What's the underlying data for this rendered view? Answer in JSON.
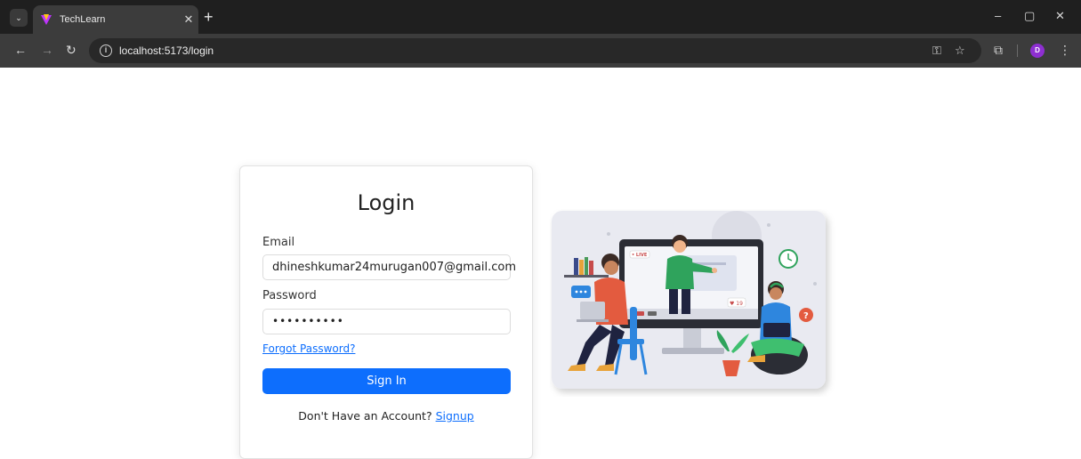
{
  "browser": {
    "tab_title": "TechLearn",
    "url": "localhost:5173/login",
    "profile_initial": "D",
    "icons": [
      "tab-menu-icon",
      "close-icon",
      "new-tab-icon",
      "minimize-icon",
      "restore-icon",
      "window-close-icon",
      "back-icon",
      "forward-icon",
      "reload-icon",
      "site-info-icon",
      "password-key-icon",
      "bookmark-star-icon",
      "extensions-icon",
      "more-menu-icon"
    ]
  },
  "login": {
    "title": "Login",
    "email_label": "Email",
    "email_value": "dhineshkumar24murugan007@gmail.com",
    "password_label": "Password",
    "password_value": "••••••••••",
    "forgot_label": "Forgot Password?",
    "signin_label": "Sign In",
    "signup_prompt": "Don't Have an Account?",
    "signup_link": "Signup"
  },
  "illustration": {
    "live_badge": "• LIVE",
    "counter_badge": "♥ 19"
  },
  "colors": {
    "primary": "#0d6efd",
    "chrome_dark": "#1f1f1f",
    "chrome_toolbar": "#3c3c3c",
    "avatar": "#8e2fd1"
  }
}
